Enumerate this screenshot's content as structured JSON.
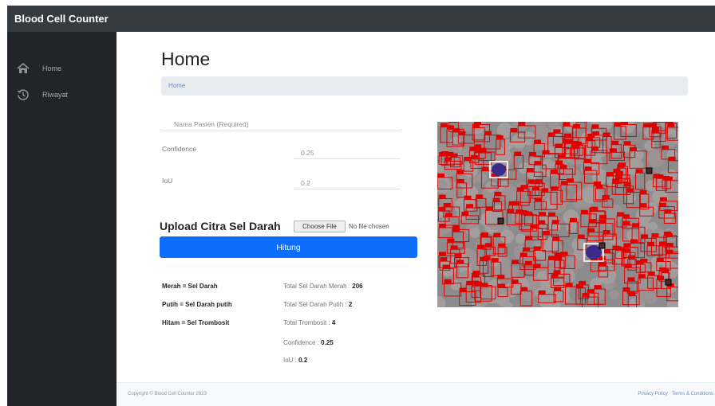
{
  "app": {
    "brand": "Blood Cell Counter"
  },
  "sidebar": {
    "items": [
      {
        "label": "Home",
        "icon": "home-icon"
      },
      {
        "label": "Riwayat",
        "icon": "history-icon"
      }
    ]
  },
  "main": {
    "title": "Home",
    "breadcrumb": "Home"
  },
  "form": {
    "patient_placeholder": "Nama Pasien (Required)",
    "confidence_label": "Confidence",
    "confidence_value": "0.25",
    "iou_label": "IoU",
    "iou_value": "0.2",
    "upload_title": "Upload Citra Sel Darah",
    "choose_file": "Choose File",
    "no_file": "No file chosen",
    "submit": "Hitung"
  },
  "legend": {
    "red": "Merah = Sel Darah",
    "white": "Putih = Sel Darah putih",
    "black": "Hitam = Sel Trombosit"
  },
  "results": {
    "red_label": "Total Sel Darah Merah :",
    "red_value": "206",
    "white_label": "Total Sel Darah Putih :",
    "white_value": "2",
    "platelet_label": "Total Trombosit :",
    "platelet_value": "4",
    "confidence_label": "Confidence :",
    "confidence_value": "0.25",
    "iou_label": "IoU :",
    "iou_value": "0.2"
  },
  "footer": {
    "copyright": "Copyright © Blood Cell Counter 2023",
    "links": "Privacy Policy · Terms & Conditions"
  },
  "colors": {
    "topbar": "#343a40",
    "sidebar": "#212529",
    "primary": "#0d6efd",
    "box_red": "#e00000",
    "box_white": "#ffffff"
  }
}
